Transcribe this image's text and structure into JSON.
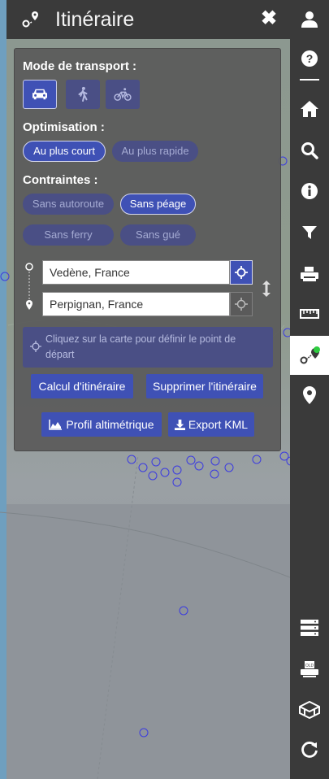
{
  "header": {
    "title": "Itinéraire",
    "close_glyph": "✖",
    "icon": "route-marker-icon"
  },
  "transport": {
    "title": "Mode de transport :",
    "modes": [
      {
        "name": "car-icon",
        "active": true
      },
      {
        "name": "walk-icon",
        "active": false
      },
      {
        "name": "bike-icon",
        "active": false
      }
    ]
  },
  "optimisation": {
    "title": "Optimisation :",
    "shortest": "Au plus court",
    "fastest": "Au plus rapide",
    "selected": "Au plus court"
  },
  "contraintes": {
    "title": "Contraintes :",
    "no_highway": "Sans autoroute",
    "no_toll": "Sans péage",
    "no_ferry": "Sans ferry",
    "no_ford": "Sans gué",
    "selected": [
      "Sans péage"
    ]
  },
  "route": {
    "start": "Vedène, France",
    "end": "Perpignan, France",
    "hint": "Cliquez sur la carte pour définir le point de départ"
  },
  "actions": {
    "calculate": "Calcul d'itinéraire",
    "delete": "Supprimer l'itinéraire",
    "profile": "Profil altimétrique",
    "export": "Export KML"
  },
  "toolbar": {
    "items": [
      "user-icon",
      "help-icon",
      "home-icon",
      "search-icon",
      "info-icon",
      "filter-icon",
      "print-icon",
      "ruler-icon",
      "route-icon",
      "marker-icon",
      "layers-icon",
      "print-old-icon",
      "map-3d-icon",
      "refresh-icon"
    ],
    "active": "route-icon"
  },
  "colors": {
    "accent": "#3f51b5",
    "panel": "#5a5a5a",
    "toolbar": "#3a3a3a"
  }
}
